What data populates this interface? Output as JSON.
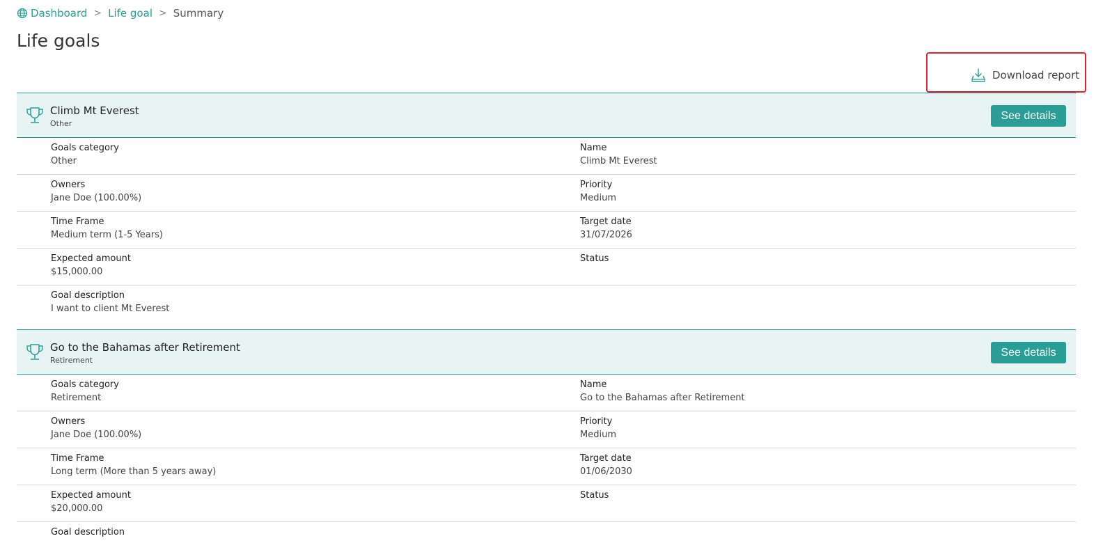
{
  "breadcrumb": {
    "dashboard": "Dashboard",
    "life_goal": "Life goal",
    "separator": ">",
    "current": "Summary"
  },
  "page_title": "Life goals",
  "download_label": "Download report",
  "see_details_label": "See details",
  "colors": {
    "accent": "#2a9d96",
    "header_bg": "#e8f4f3",
    "highlight": "#e0202a"
  },
  "goals": [
    {
      "title": "Climb Mt Everest",
      "subtitle": "Other",
      "rows": [
        {
          "l_label": "Goals category",
          "l_value": "Other",
          "r_label": "Name",
          "r_value": "Climb Mt Everest"
        },
        {
          "l_label": "Owners",
          "l_value": "Jane Doe (100.00%)",
          "r_label": "Priority",
          "r_value": "Medium"
        },
        {
          "l_label": "Time Frame",
          "l_value": "Medium term (1-5 Years)",
          "r_label": "Target date",
          "r_value": "31/07/2026"
        },
        {
          "l_label": "Expected amount",
          "l_value": "$15,000.00",
          "r_label": "Status",
          "r_value": ""
        },
        {
          "l_label": "Goal description",
          "l_value": "I want to client Mt Everest"
        }
      ]
    },
    {
      "title": "Go to the Bahamas after Retirement",
      "subtitle": "Retirement",
      "rows": [
        {
          "l_label": "Goals category",
          "l_value": "Retirement",
          "r_label": "Name",
          "r_value": "Go to the Bahamas after Retirement"
        },
        {
          "l_label": "Owners",
          "l_value": "Jane Doe (100.00%)",
          "r_label": "Priority",
          "r_value": "Medium"
        },
        {
          "l_label": "Time Frame",
          "l_value": "Long term (More than 5 years away)",
          "r_label": "Target date",
          "r_value": "01/06/2030"
        },
        {
          "l_label": "Expected amount",
          "l_value": "$20,000.00",
          "r_label": "Status",
          "r_value": ""
        },
        {
          "l_label": "Goal description",
          "l_value": ""
        }
      ]
    }
  ]
}
